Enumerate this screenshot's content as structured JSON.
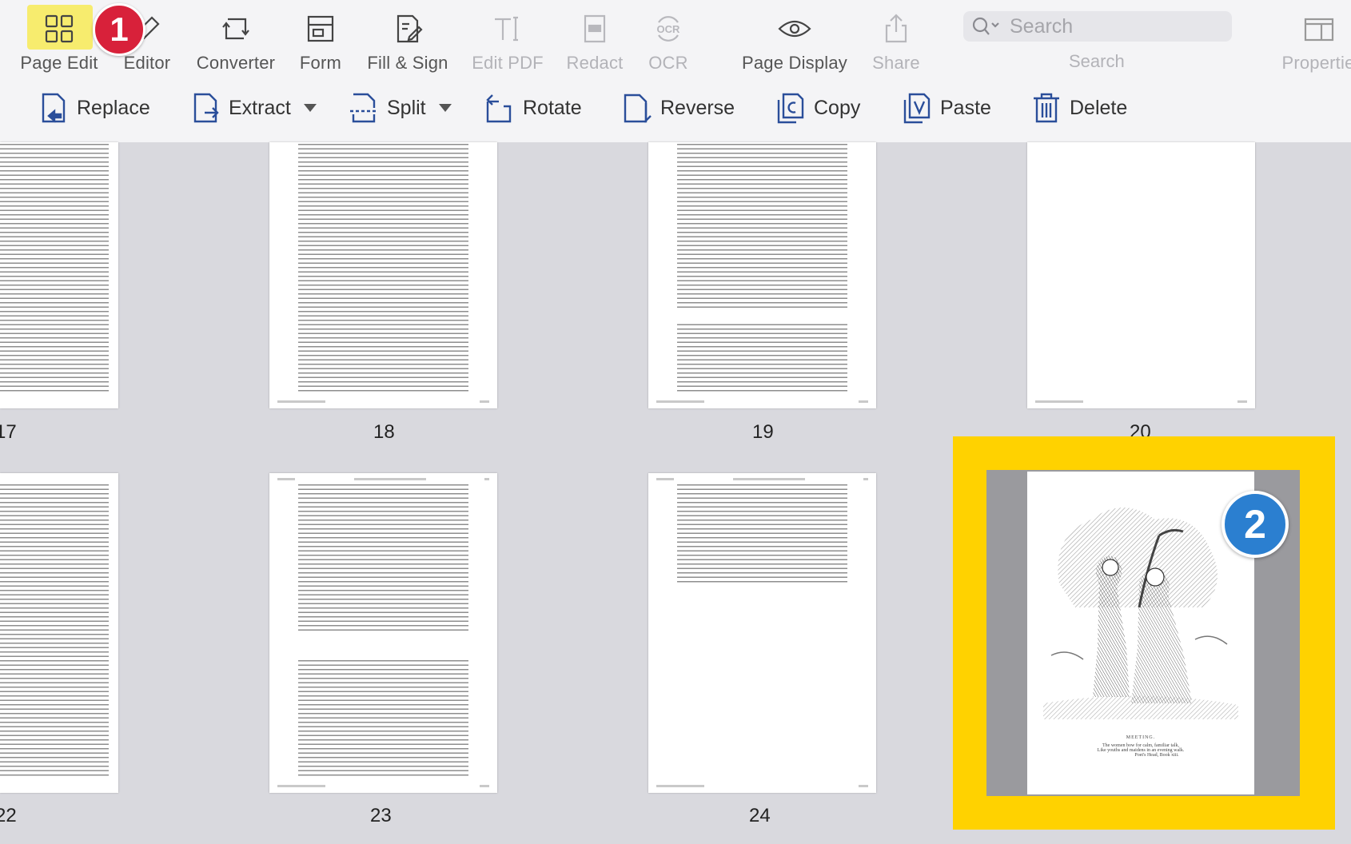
{
  "toolbar": {
    "page_edit": "Page Edit",
    "editor": "Editor",
    "converter": "Converter",
    "form": "Form",
    "fill_sign": "Fill & Sign",
    "edit_pdf": "Edit PDF",
    "redact": "Redact",
    "ocr": "OCR",
    "ocr_icon_text": "OCR",
    "page_display": "Page Display",
    "share": "Share",
    "search_label": "Search",
    "search_placeholder": "Search",
    "properties": "Propertie"
  },
  "page_edit_toolbar": {
    "replace": "Replace",
    "extract": "Extract",
    "split": "Split",
    "rotate": "Rotate",
    "reverse": "Reverse",
    "copy": "Copy",
    "paste": "Paste",
    "delete": "Delete"
  },
  "annotations": {
    "badge_1": "1",
    "badge_2": "2"
  },
  "pages": [
    {
      "number": "17",
      "visible_label": "17"
    },
    {
      "number": "18",
      "visible_label": "18"
    },
    {
      "number": "19",
      "visible_label": "19"
    },
    {
      "number": "20",
      "visible_label": "20"
    },
    {
      "number": "22",
      "visible_label": "22"
    },
    {
      "number": "23",
      "visible_label": "23"
    },
    {
      "number": "24",
      "visible_label": "24"
    }
  ],
  "selected_page": {
    "caption_title": "MEETING.",
    "caption_line1": "The women bow for calm, familiar talk,",
    "caption_line2": "Like youths and maidens in an evening walk.",
    "caption_line3": "Poet's Head, Book xiii."
  },
  "colors": {
    "highlight_yellow": "#ffd200",
    "page_edit_highlight": "#f7ec6e",
    "badge_red": "#d8213a",
    "badge_blue": "#2b7fd0",
    "icon_blue": "#2a4e9a"
  }
}
